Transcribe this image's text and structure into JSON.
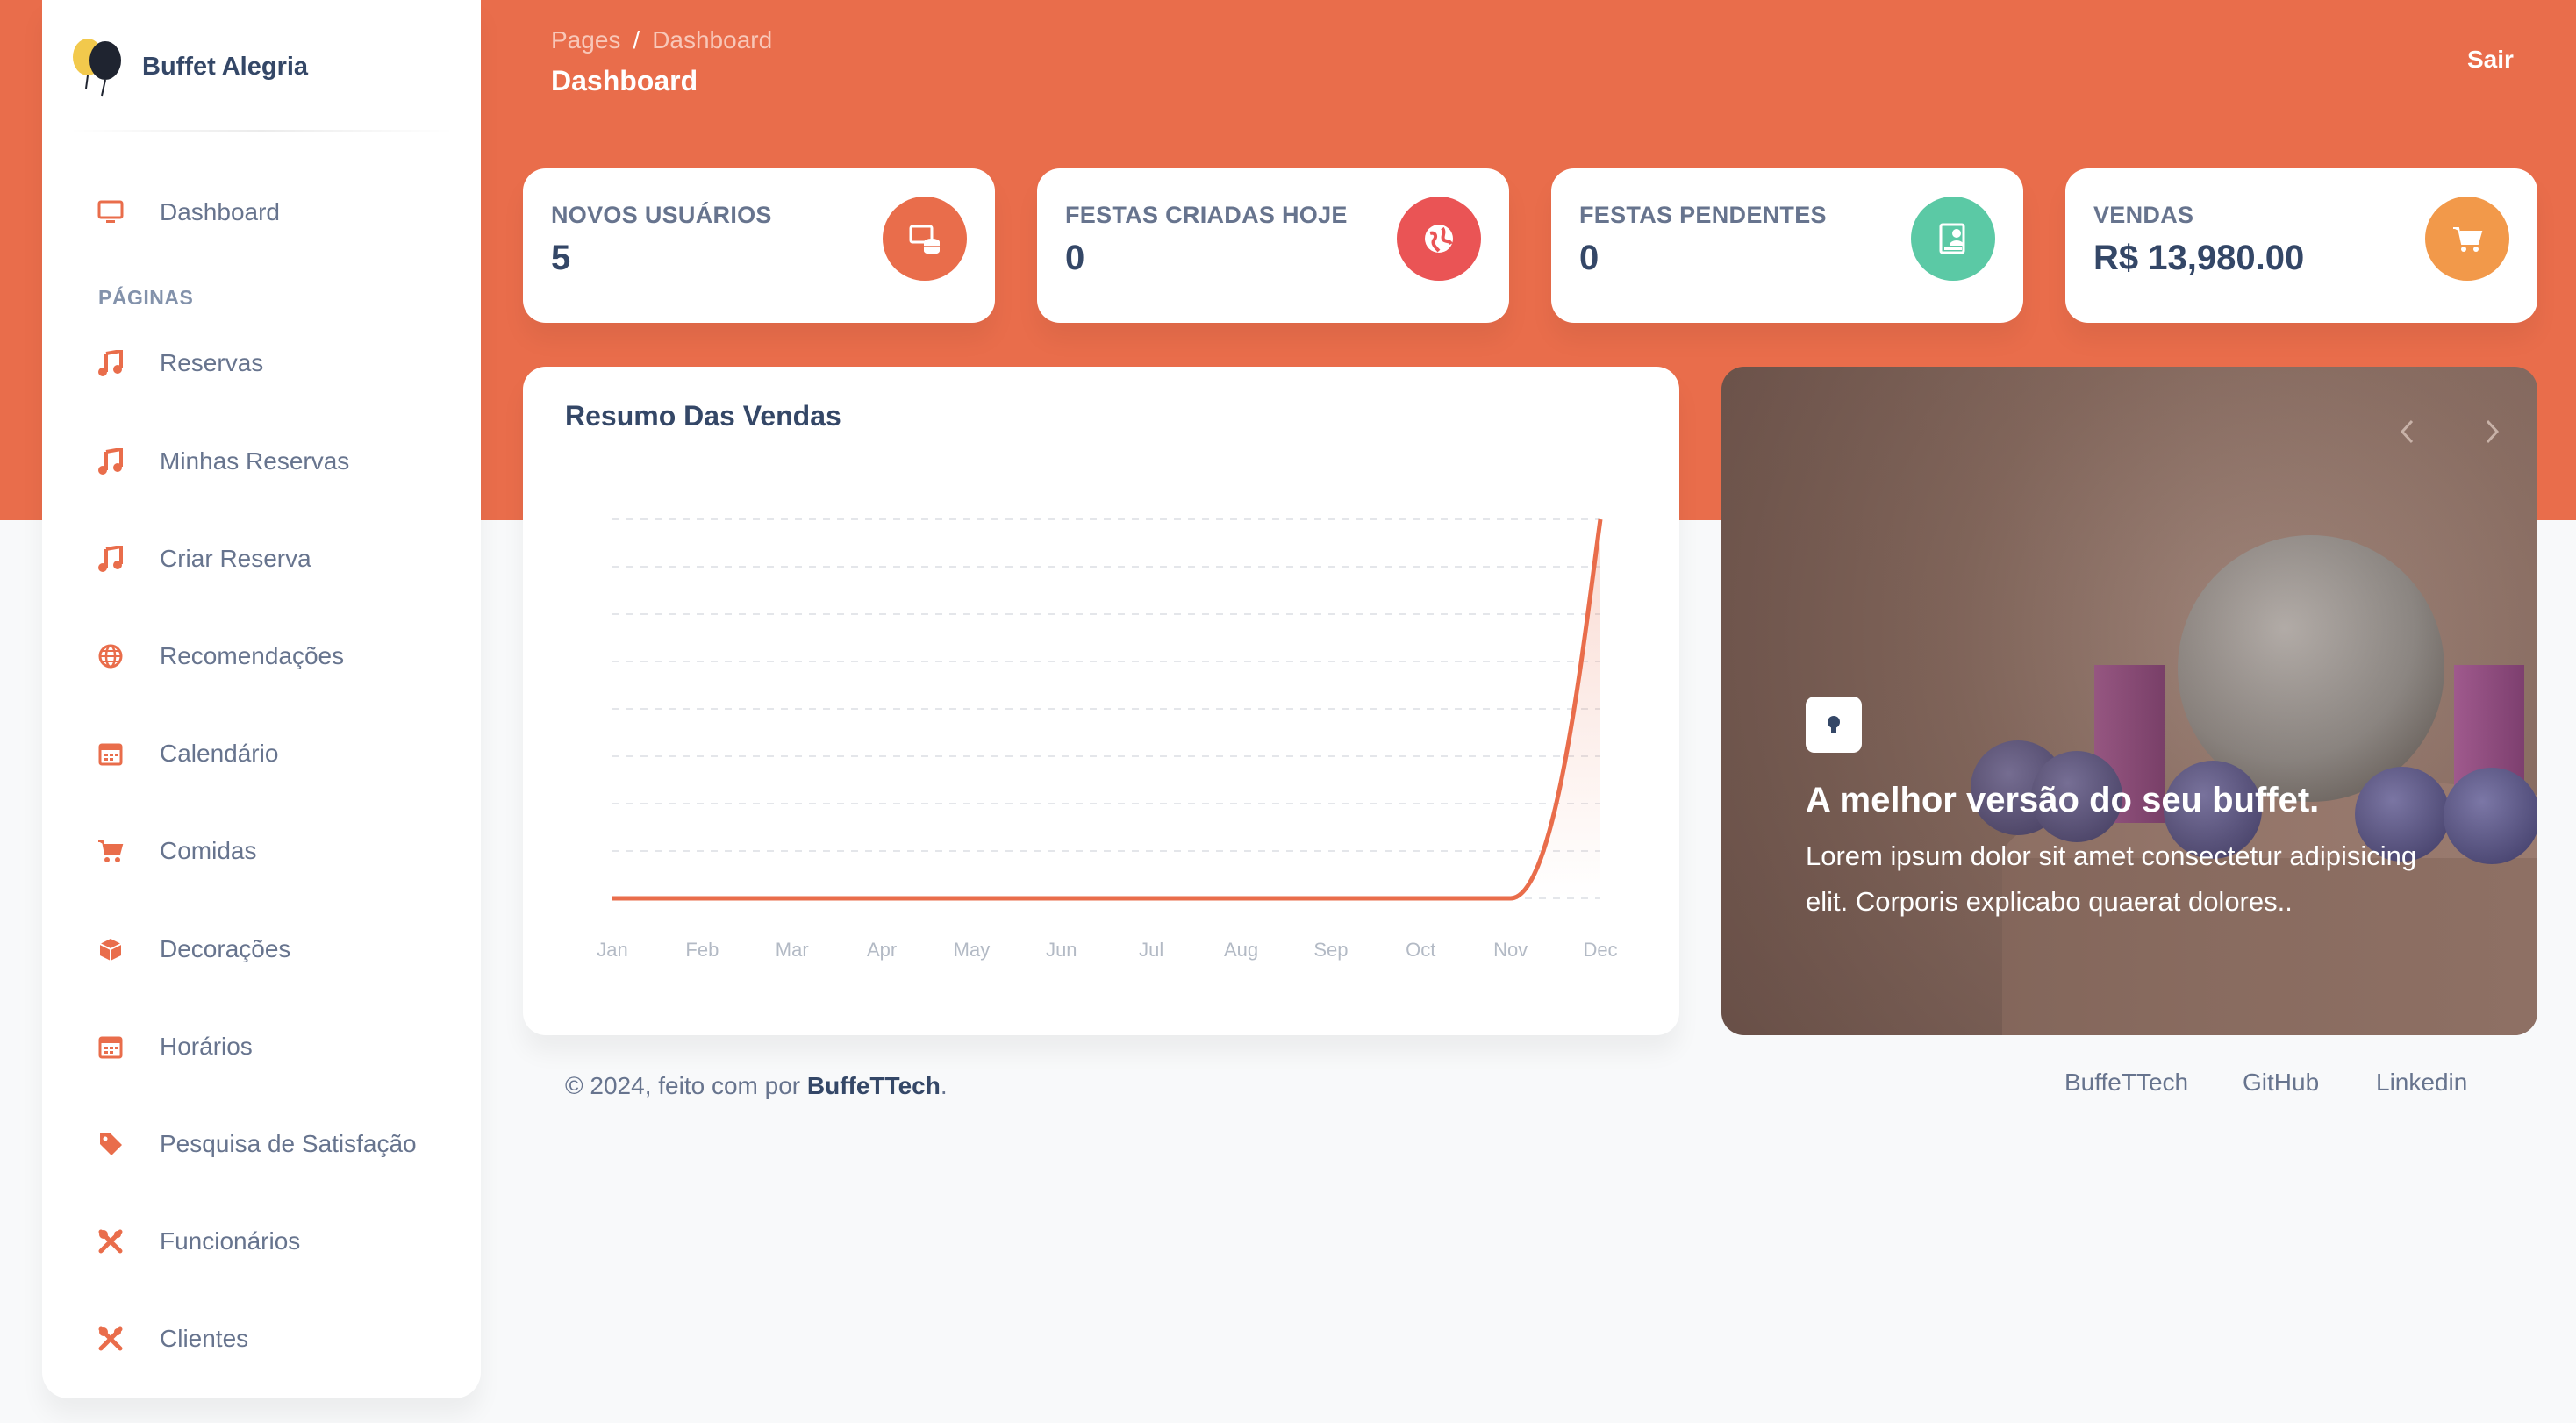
{
  "brand": {
    "name": "Buffet Alegria"
  },
  "colors": {
    "primary": "#e96d4b",
    "red": "#ea5455",
    "teal": "#5bc9a5",
    "orange": "#f2994a",
    "text_dark": "#344767",
    "text_muted": "#67748e"
  },
  "sidebar": {
    "top_item": {
      "label": "Dashboard",
      "icon": "monitor-icon"
    },
    "section_label": "PÁGINAS",
    "items": [
      {
        "label": "Reservas",
        "icon": "music-note-icon"
      },
      {
        "label": "Minhas Reservas",
        "icon": "music-note-icon"
      },
      {
        "label": "Criar Reserva",
        "icon": "music-note-icon"
      },
      {
        "label": "Recomendações",
        "icon": "globe-icon"
      },
      {
        "label": "Calendário",
        "icon": "calendar-icon"
      },
      {
        "label": "Comidas",
        "icon": "cart-icon"
      },
      {
        "label": "Decorações",
        "icon": "box-icon"
      },
      {
        "label": "Horários",
        "icon": "calendar-icon"
      },
      {
        "label": "Pesquisa de Satisfação",
        "icon": "tag-icon"
      },
      {
        "label": "Funcionários",
        "icon": "tools-icon"
      },
      {
        "label": "Clientes",
        "icon": "tools-icon"
      }
    ]
  },
  "header": {
    "breadcrumb_root": "Pages",
    "breadcrumb_separator": "/",
    "breadcrumb_current": "Dashboard",
    "title": "Dashboard",
    "logout_label": "Sair"
  },
  "stats": [
    {
      "label": "NOVOS USUÁRIOS",
      "value": "5",
      "icon": "database-icon",
      "color": "#e96d4b"
    },
    {
      "label": "FESTAS CRIADAS HOJE",
      "value": "0",
      "icon": "globe-icon",
      "color": "#ea5455"
    },
    {
      "label": "FESTAS PENDENTES",
      "value": "0",
      "icon": "document-user-icon",
      "color": "#5bc9a5"
    },
    {
      "label": "VENDAS",
      "value": "R$ 13,980.00",
      "icon": "cart-icon",
      "color": "#f2994a"
    }
  ],
  "chart_data": {
    "type": "area",
    "title": "Resumo Das Vendas",
    "categories": [
      "Jan",
      "Feb",
      "Mar",
      "Apr",
      "May",
      "Jun",
      "Jul",
      "Aug",
      "Sep",
      "Oct",
      "Nov",
      "Dec"
    ],
    "series": [
      {
        "values": [
          0,
          0,
          0,
          0,
          0,
          0,
          0,
          0,
          0,
          0,
          0,
          13980
        ],
        "color": "#e96d4b"
      }
    ],
    "ylim": [
      0,
      13980
    ],
    "grid": true,
    "gridlines": 9
  },
  "carousel": {
    "heading": "A melhor versão do seu buffet.",
    "body": "Lorem ipsum dolor sit amet consectetur adipisicing elit. Corporis explicabo quaerat dolores..",
    "badge_icon": "lightbulb-icon",
    "prev_icon": "chevron-left-icon",
    "next_icon": "chevron-right-icon"
  },
  "footer": {
    "copy_prefix": "© 2024, feito com por",
    "copy_brand": "BuffeTTech",
    "copy_suffix": ".",
    "links": [
      "BuffeTTech",
      "GitHub",
      "Linkedin"
    ]
  }
}
